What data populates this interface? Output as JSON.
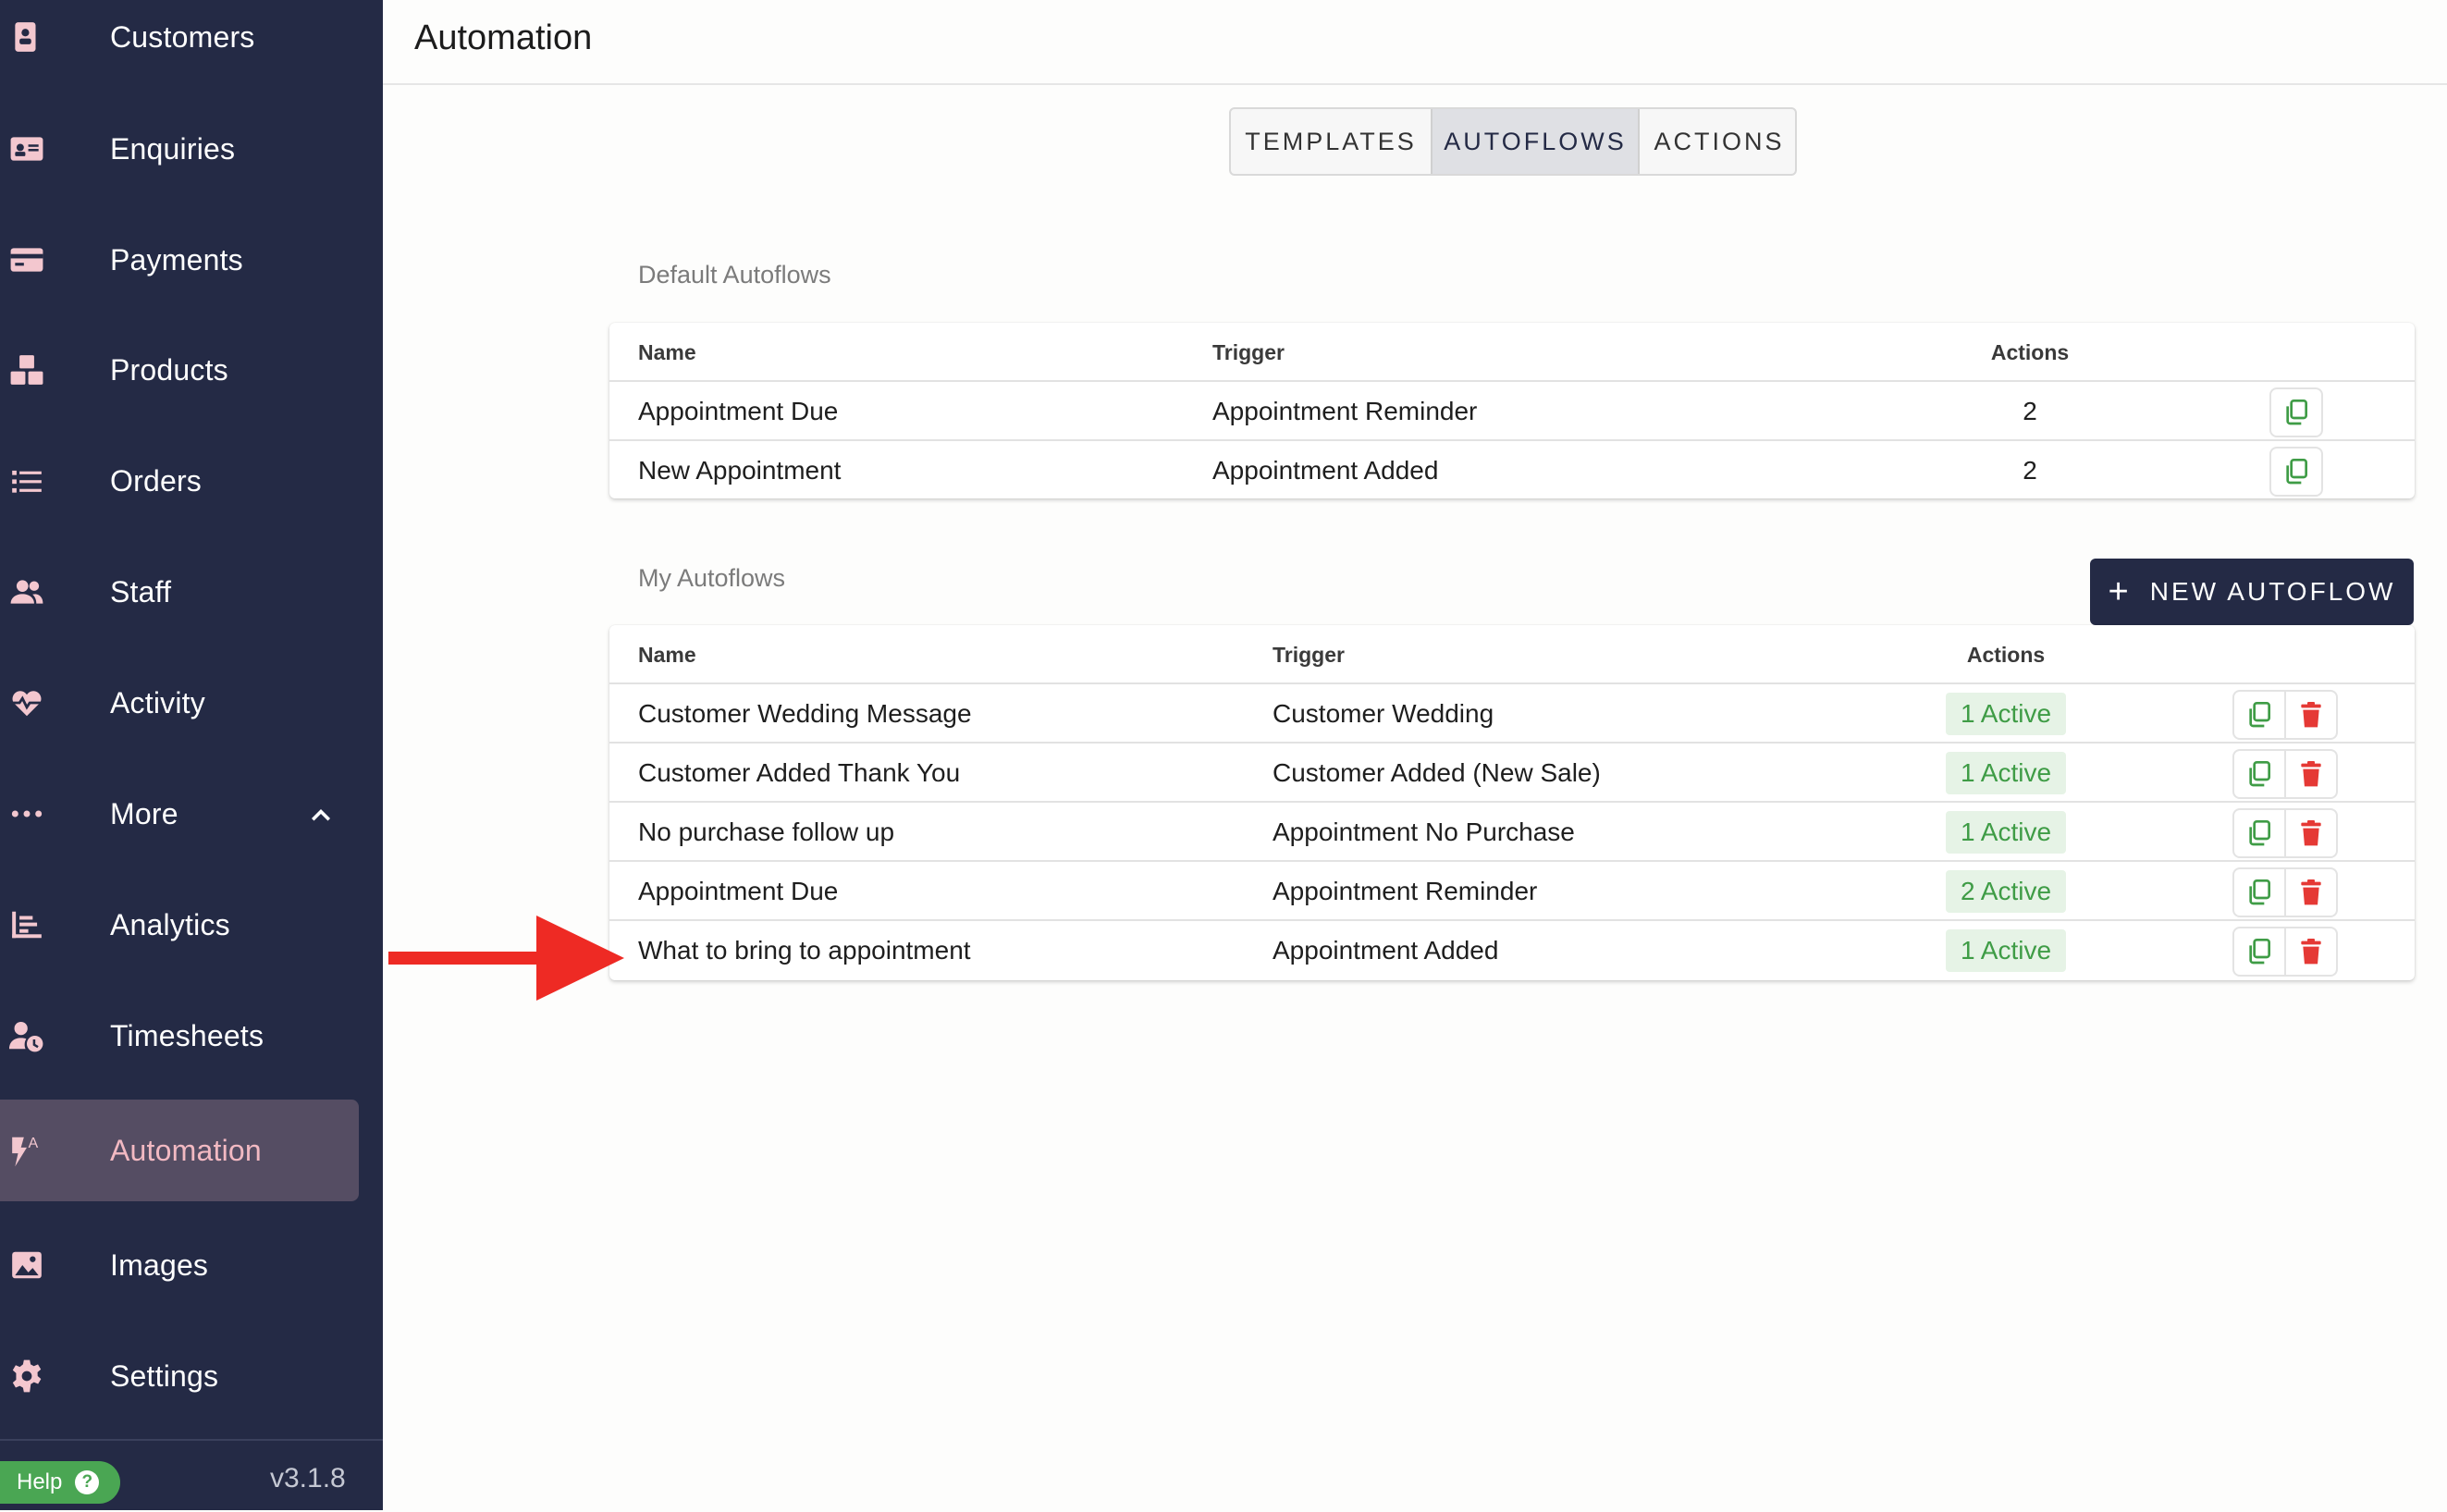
{
  "sidebar": {
    "items": [
      {
        "label": "Customers",
        "icon": "contact-card-icon"
      },
      {
        "label": "Enquiries",
        "icon": "id-card-icon"
      },
      {
        "label": "Payments",
        "icon": "credit-card-icon"
      },
      {
        "label": "Products",
        "icon": "boxes-icon"
      },
      {
        "label": "Orders",
        "icon": "list-icon"
      },
      {
        "label": "Staff",
        "icon": "users-icon"
      },
      {
        "label": "Activity",
        "icon": "heart-pulse-icon"
      },
      {
        "label": "More",
        "icon": "dots-icon"
      },
      {
        "label": "Analytics",
        "icon": "bar-chart-icon"
      },
      {
        "label": "Timesheets",
        "icon": "user-clock-icon"
      },
      {
        "label": "Automation",
        "icon": "bolt-a-icon"
      },
      {
        "label": "Images",
        "icon": "image-icon"
      },
      {
        "label": "Settings",
        "icon": "gear-icon"
      }
    ],
    "active": "Automation",
    "help_label": "Help",
    "help_icon": "question-icon",
    "version": "v3.1.8"
  },
  "header": {
    "title": "Automation"
  },
  "tabs": [
    "TEMPLATES",
    "AUTOFLOWS",
    "ACTIONS"
  ],
  "active_tab": "AUTOFLOWS",
  "default_section": {
    "label": "Default Autoflows",
    "columns": {
      "name": "Name",
      "trigger": "Trigger",
      "actions": "Actions"
    },
    "rows": [
      {
        "name": "Appointment Due",
        "trigger": "Appointment Reminder",
        "actions": "2"
      },
      {
        "name": "New Appointment",
        "trigger": "Appointment Added",
        "actions": "2"
      }
    ]
  },
  "my_section": {
    "label": "My Autoflows",
    "new_button": "NEW AUTOFLOW",
    "columns": {
      "name": "Name",
      "trigger": "Trigger",
      "actions": "Actions"
    },
    "rows": [
      {
        "name": "Customer Wedding Message",
        "trigger": "Customer Wedding",
        "actions": "1 Active"
      },
      {
        "name": "Customer Added Thank You",
        "trigger": "Customer Added (New Sale)",
        "actions": "1 Active"
      },
      {
        "name": "No purchase follow up",
        "trigger": "Appointment No Purchase",
        "actions": "1 Active"
      },
      {
        "name": "Appointment Due",
        "trigger": "Appointment Reminder",
        "actions": "2 Active"
      },
      {
        "name": "What to bring to appointment",
        "trigger": "Appointment Added",
        "actions": "1 Active"
      }
    ]
  },
  "colors": {
    "sidebar_bg": "#242a45",
    "icon_pink": "#f3c7cf",
    "active_item_bg": "#554d63",
    "badge_bg": "#e6f3e6",
    "badge_text": "#3f9c46",
    "copy_icon": "#3f9c46",
    "delete_icon": "#e53935",
    "arrow": "#ee2a24"
  }
}
